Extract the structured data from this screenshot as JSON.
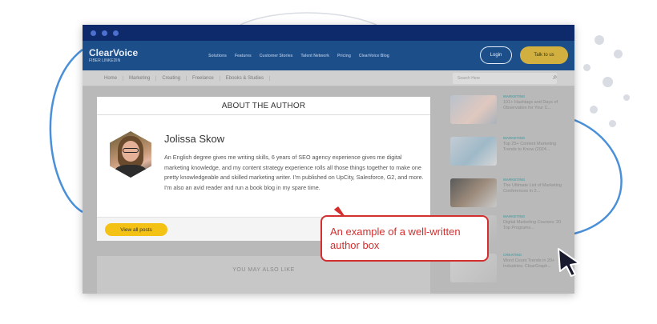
{
  "colors": {
    "chrome": "#0f2a6a",
    "nav": "#1c4f8a",
    "accent_yellow": "#f4c215",
    "callout_red": "#d32f2f",
    "deco_blue": "#4a90d9"
  },
  "site": {
    "logo": "ClearVoice",
    "logo_sub": "FIBER LINKEDIN",
    "nav_links": [
      "Solutions",
      "Features",
      "Customer Stories",
      "Talent Network",
      "Pricing",
      "ClearVoice Blog"
    ],
    "login_label": "Login",
    "talk_label": "Talk to us"
  },
  "subnav": {
    "crumbs": [
      "Home",
      "Marketing",
      "Creating",
      "Freelance",
      "Ebooks & Studies"
    ],
    "search_placeholder": "Search Here"
  },
  "author_box": {
    "heading": "ABOUT THE AUTHOR",
    "name": "Jolissa Skow",
    "bio": "An English degree gives me writing skills, 6 years of SEO agency experience gives me digital marketing knowledge, and my content strategy experience rolls all those things together to make one pretty knowledgeable and skilled marketing writer. I'm published on UpCity, Salesforce, G2, and more. I'm also an avid reader and run a book blog in my spare time.",
    "view_all_label": "View all posts",
    "avatar_icon": "author-photo"
  },
  "also_like": {
    "heading": "YOU MAY ALSO LIKE"
  },
  "sidebar": {
    "items": [
      {
        "category": "MARKETING",
        "title": "101+ Hashtags and Days of Observation for Your C..."
      },
      {
        "category": "MARKETING",
        "title": "Top 25+ Content Marketing Trends to Know (2024..."
      },
      {
        "category": "MARKETING",
        "title": "The Ultimate List of Marketing Conferences in 2..."
      },
      {
        "category": "MARKETING",
        "title": "Digital Marketing Courses: 20 Top Programs..."
      },
      {
        "category": "CREATING",
        "title": "Word Count Trends in 20+ Industries: ClearGraph..."
      }
    ]
  },
  "callout": {
    "line1": "An example of a well-written",
    "line2": "author box"
  },
  "cursor_icon": "mouse-pointer-icon"
}
